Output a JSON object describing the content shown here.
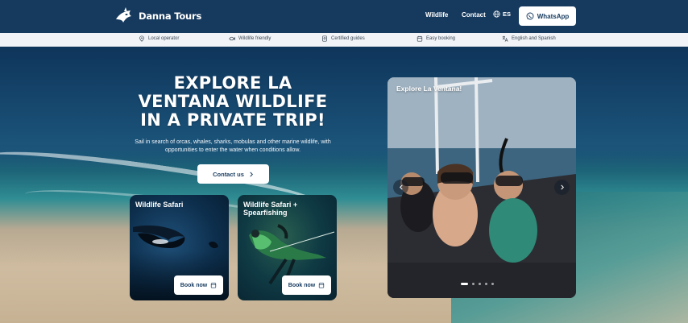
{
  "brand": {
    "name": "Danna Tours"
  },
  "nav": {
    "wildlife": "Wildlife",
    "contact": "Contact",
    "lang": "ES",
    "whatsapp": "WhatsApp"
  },
  "features": [
    {
      "label": "Local operator",
      "icon": "location-pin-icon"
    },
    {
      "label": "Wildlife friendly",
      "icon": "fish-icon"
    },
    {
      "label": "Certified guides",
      "icon": "certificate-icon"
    },
    {
      "label": "Easy booking",
      "icon": "calendar-icon"
    },
    {
      "label": "English and Spanish",
      "icon": "translate-icon"
    }
  ],
  "hero": {
    "title": "EXPLORE LA VENTANA WILDLIFE IN A PRIVATE TRIP!",
    "subtitle": "Sail in search of orcas, whales, sharks, mobulas and other marine wildlife, with opportunities to enter the water when conditions allow.",
    "cta": "Contact us"
  },
  "cards": [
    {
      "title": "Wildlife Safari",
      "button": "Book now"
    },
    {
      "title": "Wildlife Safari + Spearfishing",
      "button": "Book now"
    }
  ],
  "carousel": {
    "title": "Explore La Ventana!",
    "slide_count": 5,
    "active_slide": 1
  },
  "colors": {
    "nav_bg": "#163a5e",
    "feature_bg": "#f1f3f6",
    "accent_text": "#163a5e"
  }
}
